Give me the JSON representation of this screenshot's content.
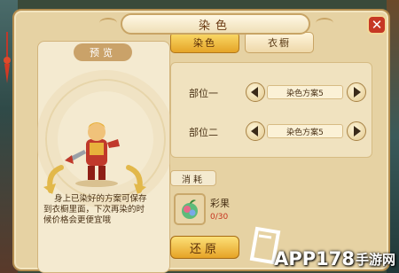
{
  "window": {
    "title": "染色",
    "close_label": "✕"
  },
  "preview": {
    "label": "预览",
    "hint_lines": [
      "身上已染好的方案可保存",
      "到衣橱里面，下次再染的时",
      "候价格会更便宜哦"
    ]
  },
  "tabs": [
    {
      "label": "染色",
      "active": true
    },
    {
      "label": "衣橱",
      "active": false
    }
  ],
  "parts": [
    {
      "label": "部位一",
      "scheme": "染色方案5"
    },
    {
      "label": "部位二",
      "scheme": "染色方案5"
    }
  ],
  "consume": {
    "label": "消耗",
    "item_name": "彩果",
    "item_count": "0/30"
  },
  "restore_label": "还原",
  "watermark": {
    "brand": "APP178",
    "suffix": "手游网"
  },
  "colors": {
    "panel_bg": "#e6d2a3",
    "accent_gold": "#e5a427",
    "close_red": "#c63824",
    "count_red": "#c6341f"
  }
}
